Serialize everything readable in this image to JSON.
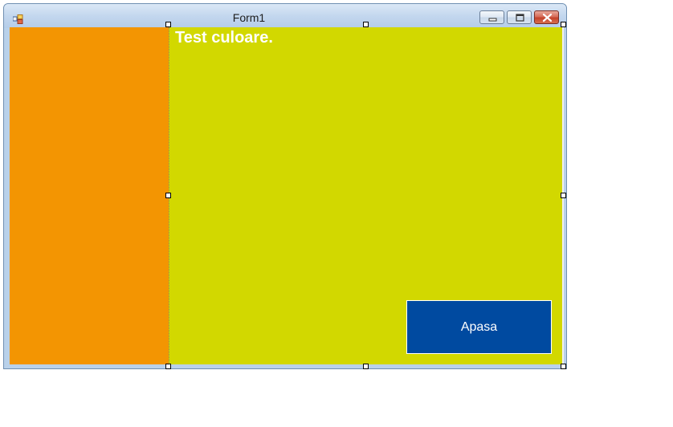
{
  "window": {
    "title": "Form1",
    "app_icon": "winforms-app-icon",
    "controls": {
      "minimize": "minimize-icon",
      "maximize": "maximize-icon",
      "close": "close-icon"
    }
  },
  "form": {
    "label_text": "Test culoare.",
    "button_label": "Apasa"
  },
  "colors": {
    "left_panel": "#f39502",
    "right_panel": "#d2d800",
    "button": "#004aa0",
    "label_text": "#ffffff"
  }
}
